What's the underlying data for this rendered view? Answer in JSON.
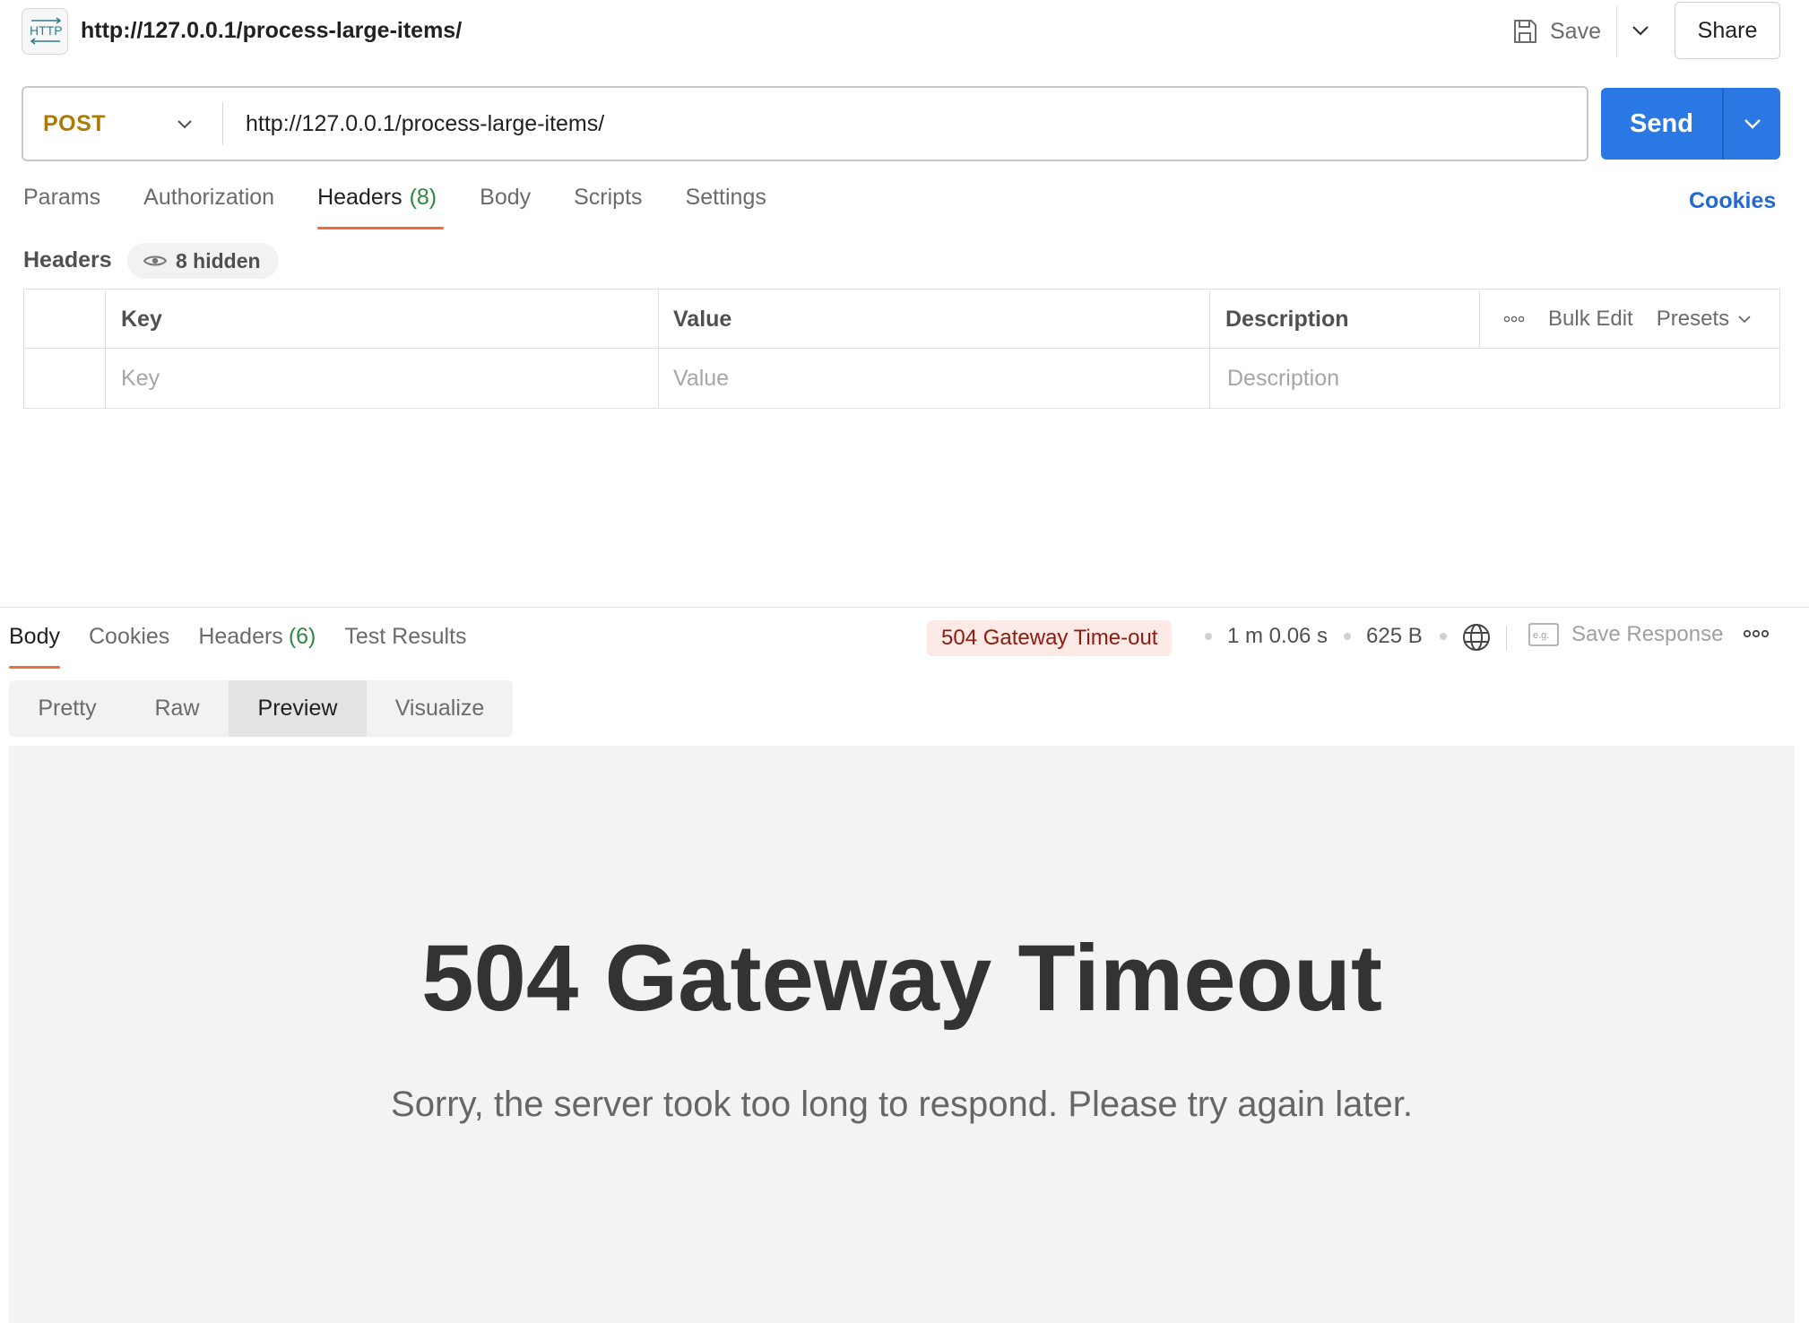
{
  "request": {
    "title": "http://127.0.0.1/process-large-items/",
    "method": "POST",
    "url": "http://127.0.0.1/process-large-items/",
    "icon": "http-icon"
  },
  "toolbar": {
    "save_label": "Save",
    "share_label": "Share",
    "send_label": "Send"
  },
  "request_tabs": [
    {
      "label": "Params"
    },
    {
      "label": "Authorization"
    },
    {
      "label": "Headers",
      "count": "(8)",
      "active": true
    },
    {
      "label": "Body"
    },
    {
      "label": "Scripts"
    },
    {
      "label": "Settings"
    }
  ],
  "cookies_link": "Cookies",
  "headers_section": {
    "label": "Headers",
    "hidden_badge": "8 hidden",
    "columns": {
      "key": "Key",
      "value": "Value",
      "description": "Description"
    },
    "placeholders": {
      "key": "Key",
      "value": "Value",
      "description": "Description"
    },
    "bulk_edit": "Bulk Edit",
    "presets": "Presets"
  },
  "response_tabs": [
    {
      "label": "Body",
      "active": true
    },
    {
      "label": "Cookies"
    },
    {
      "label": "Headers",
      "count": "(6)"
    },
    {
      "label": "Test Results"
    }
  ],
  "response_meta": {
    "status": "504 Gateway Time-out",
    "time": "1 m 0.06 s",
    "size": "625 B",
    "save_response": "Save Response",
    "status_color": "#8e1a10"
  },
  "view_modes": [
    {
      "label": "Pretty"
    },
    {
      "label": "Raw"
    },
    {
      "label": "Preview",
      "active": true
    },
    {
      "label": "Visualize"
    }
  ],
  "preview": {
    "heading": "504 Gateway Timeout",
    "message": "Sorry, the server took too long to respond. Please try again later."
  },
  "colors": {
    "accent": "#2a78e4",
    "tab_underline": "#f26b3a",
    "method": "#ad7a03",
    "count": "#2c8a3e"
  }
}
